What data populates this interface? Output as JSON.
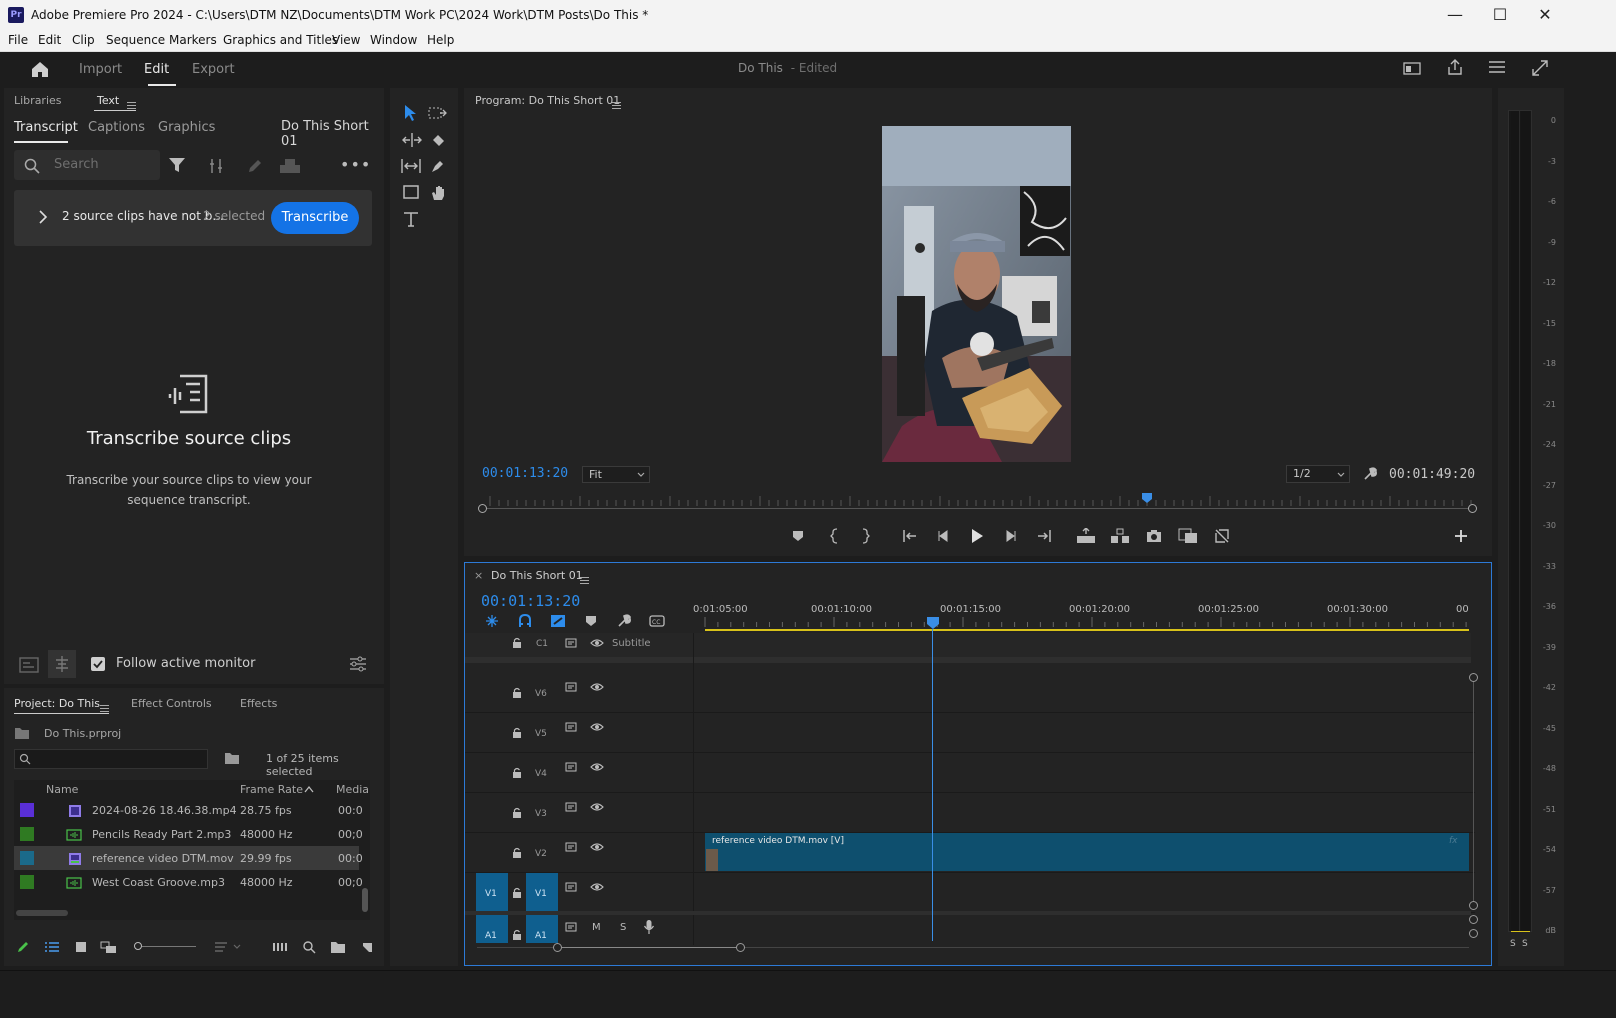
{
  "window": {
    "title": "Adobe Premiere Pro 2024 - C:\\Users\\DTM NZ\\Documents\\DTM Work PC\\2024 Work\\DTM Posts\\Do This *",
    "logo": "Pr",
    "controls": [
      "—",
      "☐",
      "✕"
    ]
  },
  "menu": [
    "File",
    "Edit",
    "Clip",
    "Sequence",
    "Markers",
    "Graphics and Titles",
    "View",
    "Window",
    "Help"
  ],
  "header": {
    "tabs": [
      "Import",
      "Edit",
      "Export"
    ],
    "active_tab": "Edit",
    "project_title": "Do This",
    "project_status": "- Edited"
  },
  "text_panel": {
    "top_tabs": [
      "Libraries",
      "Text"
    ],
    "sub_tabs": [
      "Transcript",
      "Captions",
      "Graphics"
    ],
    "sequence_name": "Do This Short 01",
    "search_placeholder": "Search",
    "notice_text": "2 source clips have not b...",
    "notice_count": "2 selected",
    "transcribe_button": "Transcribe",
    "empty_title": "Transcribe source clips",
    "empty_desc_line1": "Transcribe your source clips to view your",
    "empty_desc_line2": "sequence transcript.",
    "follow_label": "Follow active monitor"
  },
  "project_panel": {
    "tabs": [
      "Project: Do This",
      "Effect Controls",
      "Effects"
    ],
    "file_name": "Do This.prproj",
    "items_selected": "1 of 25 items selected",
    "columns": [
      "Name",
      "Frame Rate",
      "Media"
    ],
    "rows": [
      {
        "name": "2024-08-26 18.46.38.mp4",
        "rate": "28.75 fps",
        "media": "00:0",
        "color": "#5a2fd6"
      },
      {
        "name": "Pencils Ready Part 2.mp3",
        "rate": "48000 Hz",
        "media": "00;0",
        "color": "#2f7a22"
      },
      {
        "name": "reference video DTM.mov",
        "rate": "29.99 fps",
        "media": "00:0",
        "color": "#1b6a8a"
      },
      {
        "name": "West Coast Groove.mp3",
        "rate": "48000 Hz",
        "media": "00;0",
        "color": "#2f7a22"
      }
    ]
  },
  "program_monitor": {
    "title": "Program: Do This Short 01",
    "timecode": "00:01:13:20",
    "fit": "Fit",
    "resolution": "1/2",
    "duration": "00:01:49:20",
    "playhead_fraction": 0.67
  },
  "timeline": {
    "sequence_name": "Do This Short 01",
    "timecode": "00:01:13:20",
    "ruler_labels": [
      "0:01:05:00",
      "00:01:10:00",
      "00:01:15:00",
      "00:01:20:00",
      "00:01:25:00",
      "00:01:30:00",
      "00"
    ],
    "subtitle_track": {
      "id": "C1",
      "label": "Subtitle"
    },
    "video_tracks": [
      "V6",
      "V5",
      "V4",
      "V3",
      "V2",
      "V1"
    ],
    "audio_track": "A1",
    "audio_controls": [
      "M",
      "S"
    ],
    "clip_label": "reference video DTM.mov [V]",
    "clip_fx": "fx"
  },
  "audio_meter": {
    "labels": [
      "0",
      "-3",
      "-6",
      "-9",
      "-12",
      "-15",
      "-18",
      "-21",
      "-24",
      "-27",
      "-30",
      "-33",
      "-36",
      "-39",
      "-42",
      "-45",
      "-48",
      "-51",
      "-54",
      "-57",
      "dB"
    ],
    "solo": [
      "S",
      "S"
    ]
  },
  "colors": {
    "accent": "#1473e6",
    "timecode": "#2d8ceb",
    "clip": "#0e4f6e",
    "work_area": "#d8c21a",
    "playhead": "#3a8ee6"
  }
}
